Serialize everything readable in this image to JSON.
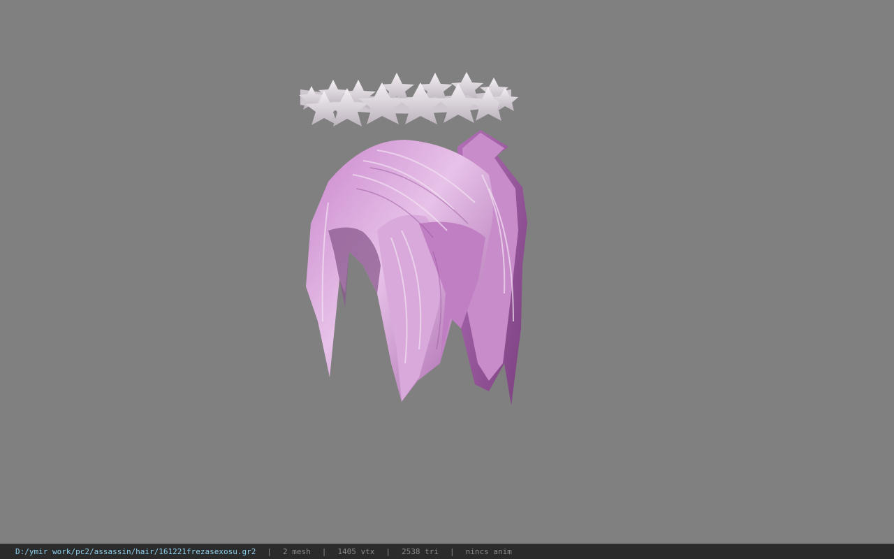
{
  "viewer": {
    "background": "#808080",
    "model": {
      "meshes": [
        "star-tiara",
        "pink-hair"
      ],
      "hair_color": "#d79ad9",
      "tiara_color": "#e8e2e8"
    }
  },
  "status": {
    "file_path": "D:/ymir work/pc2/assassin/hair/161221frezasexosu.gr2",
    "separator": "|",
    "mesh_count": "2 mesh",
    "vertex_count": "1405 vtx",
    "triangle_count": "2538 tri",
    "anim": "nincs anim"
  }
}
